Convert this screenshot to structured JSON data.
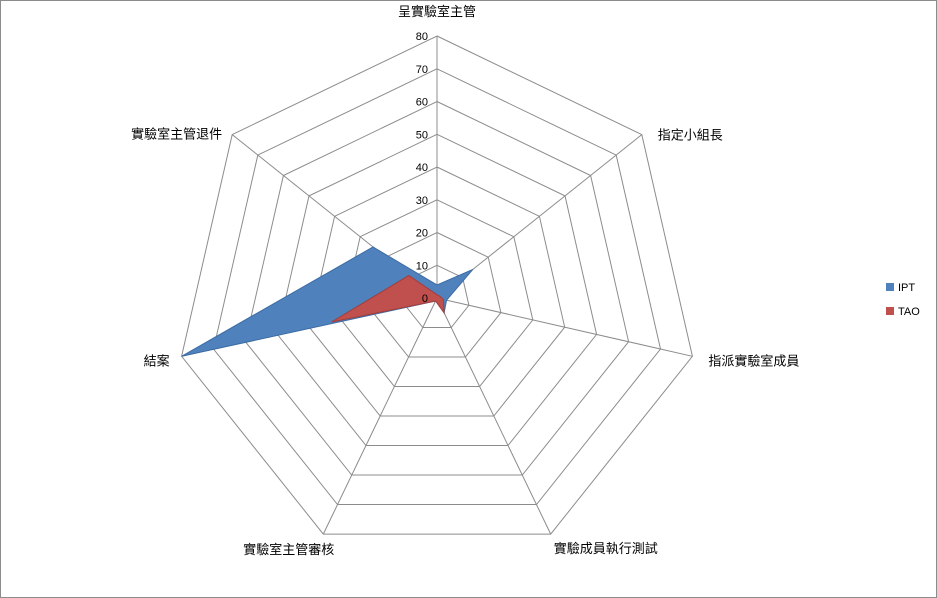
{
  "chart_data": {
    "type": "radar",
    "categories": [
      "呈實驗室主管",
      "指定小組長",
      "指派實驗室成員",
      "實驗成員執行測試",
      "實驗室主管審核",
      "結案",
      "實驗室主管退件"
    ],
    "ticks": [
      0,
      10,
      20,
      30,
      40,
      50,
      60,
      70,
      80
    ],
    "rlim": [
      0,
      80
    ],
    "series": [
      {
        "name": "IPT",
        "color": "#4f81bd",
        "values": [
          4,
          14,
          3,
          5,
          1,
          80,
          25
        ]
      },
      {
        "name": "TAO",
        "color": "#c0504d",
        "values": [
          1,
          1,
          2,
          5,
          1,
          33,
          11
        ]
      }
    ],
    "legend_position": "right",
    "grid": true
  }
}
